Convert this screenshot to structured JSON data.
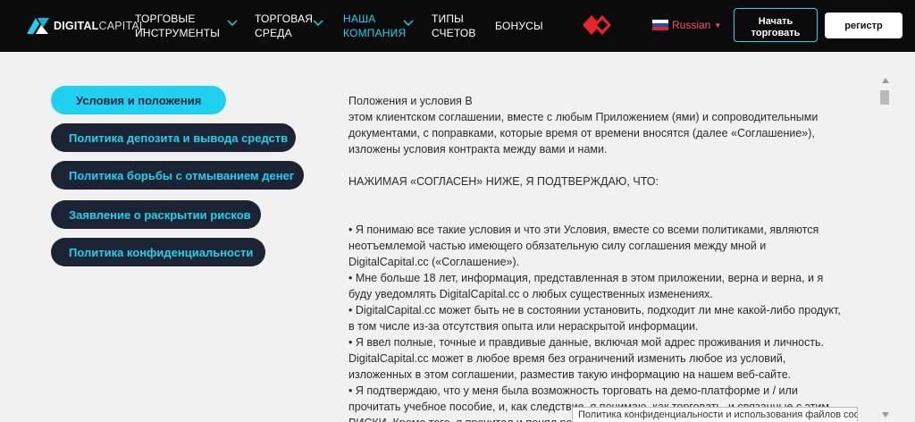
{
  "header": {
    "logo_bold": "DIGITAL",
    "logo_thin": "CAPITAL",
    "nav": [
      {
        "line1": "ТОРГОВЫЕ",
        "line2": "ИНСТРУМЕНТЫ"
      },
      {
        "line1": "ТОРГОВАЯ",
        "line2": "СРЕДА"
      },
      {
        "line1": "НАША",
        "line2": "КОМПАНИЯ"
      },
      {
        "line1": "ТИПЫ",
        "line2": "СЧЕТОВ"
      },
      {
        "line1": "БОНУСЫ",
        "line2": ""
      }
    ],
    "language": "Russian",
    "start_trading": {
      "line1": "Начать",
      "line2": "торговать"
    },
    "register": "регистр"
  },
  "colors": {
    "accent": "#1fd0f0",
    "header_bg": "#0b0b0b",
    "sidebar_btn_bg": "#1c2433",
    "brand_red": "#e8232a",
    "language_text": "#ff4b6a"
  },
  "sidebar": {
    "items": [
      {
        "label": "Условия и положения",
        "active": true
      },
      {
        "label": "Политика депозита и вывода средств",
        "active": false
      },
      {
        "label": "Политика борьбы с отмыванием денег",
        "active": false
      },
      {
        "label": "Заявление о раскрытии рисков",
        "active": false
      },
      {
        "label": "Политика конфиденциальности",
        "active": false
      }
    ]
  },
  "content": {
    "intro": [
      "Положения и условия В",
      "этом клиентском соглашении, вместе с любым Приложением (ями) и сопроводительными",
      "документами, с поправками, которые время от времени вносятся (далее «Соглашение»),",
      "изложены условия контракта между вами и нами."
    ],
    "agree_heading": "НАЖИМАЯ «СОГЛАСЕН» НИЖЕ, Я ПОДТВЕРЖДАЮ, ЧТО:",
    "bullets": [
      "• Я понимаю все такие условия и что эти Условия, вместе со всеми политиками, являются",
      "неотъемлемой частью имеющего обязательную силу соглашения между мной и",
      "DigitalCapital.cc («Соглашение»).",
      "• Мне больше 18 лет, информация, представленная в этом приложении, верна и верна, и я",
      "буду уведомлять DigitalCapital.cc о любых существенных изменениях.",
      "• DigitalCapital.cc может быть не в состоянии установить, подходит ли мне какой-либо продукт,",
      "в том числе из-за отсутствия опыта или нераскрытой информации.",
      "• Я ввел полные, точные и правдивые данные, включая мой адрес проживания и личность.",
      "DigitalCapital.cc может в любое время без ограничений изменить любое из условий,",
      "изложенных в этом соглашении, разместив такую информацию на нашем веб-сайте.",
      "• Я подтверждаю, что у меня была возможность торговать на демо-платформе и / или",
      "прочитать учебное пособие, и, как следствие, я понимаю, как торговать, и связанные с этим",
      "РИСКИ. Кроме того, я прочитал и понял раз"
    ]
  },
  "cookie_bar": "Политика конфиденциальности и использования файлов cookie"
}
